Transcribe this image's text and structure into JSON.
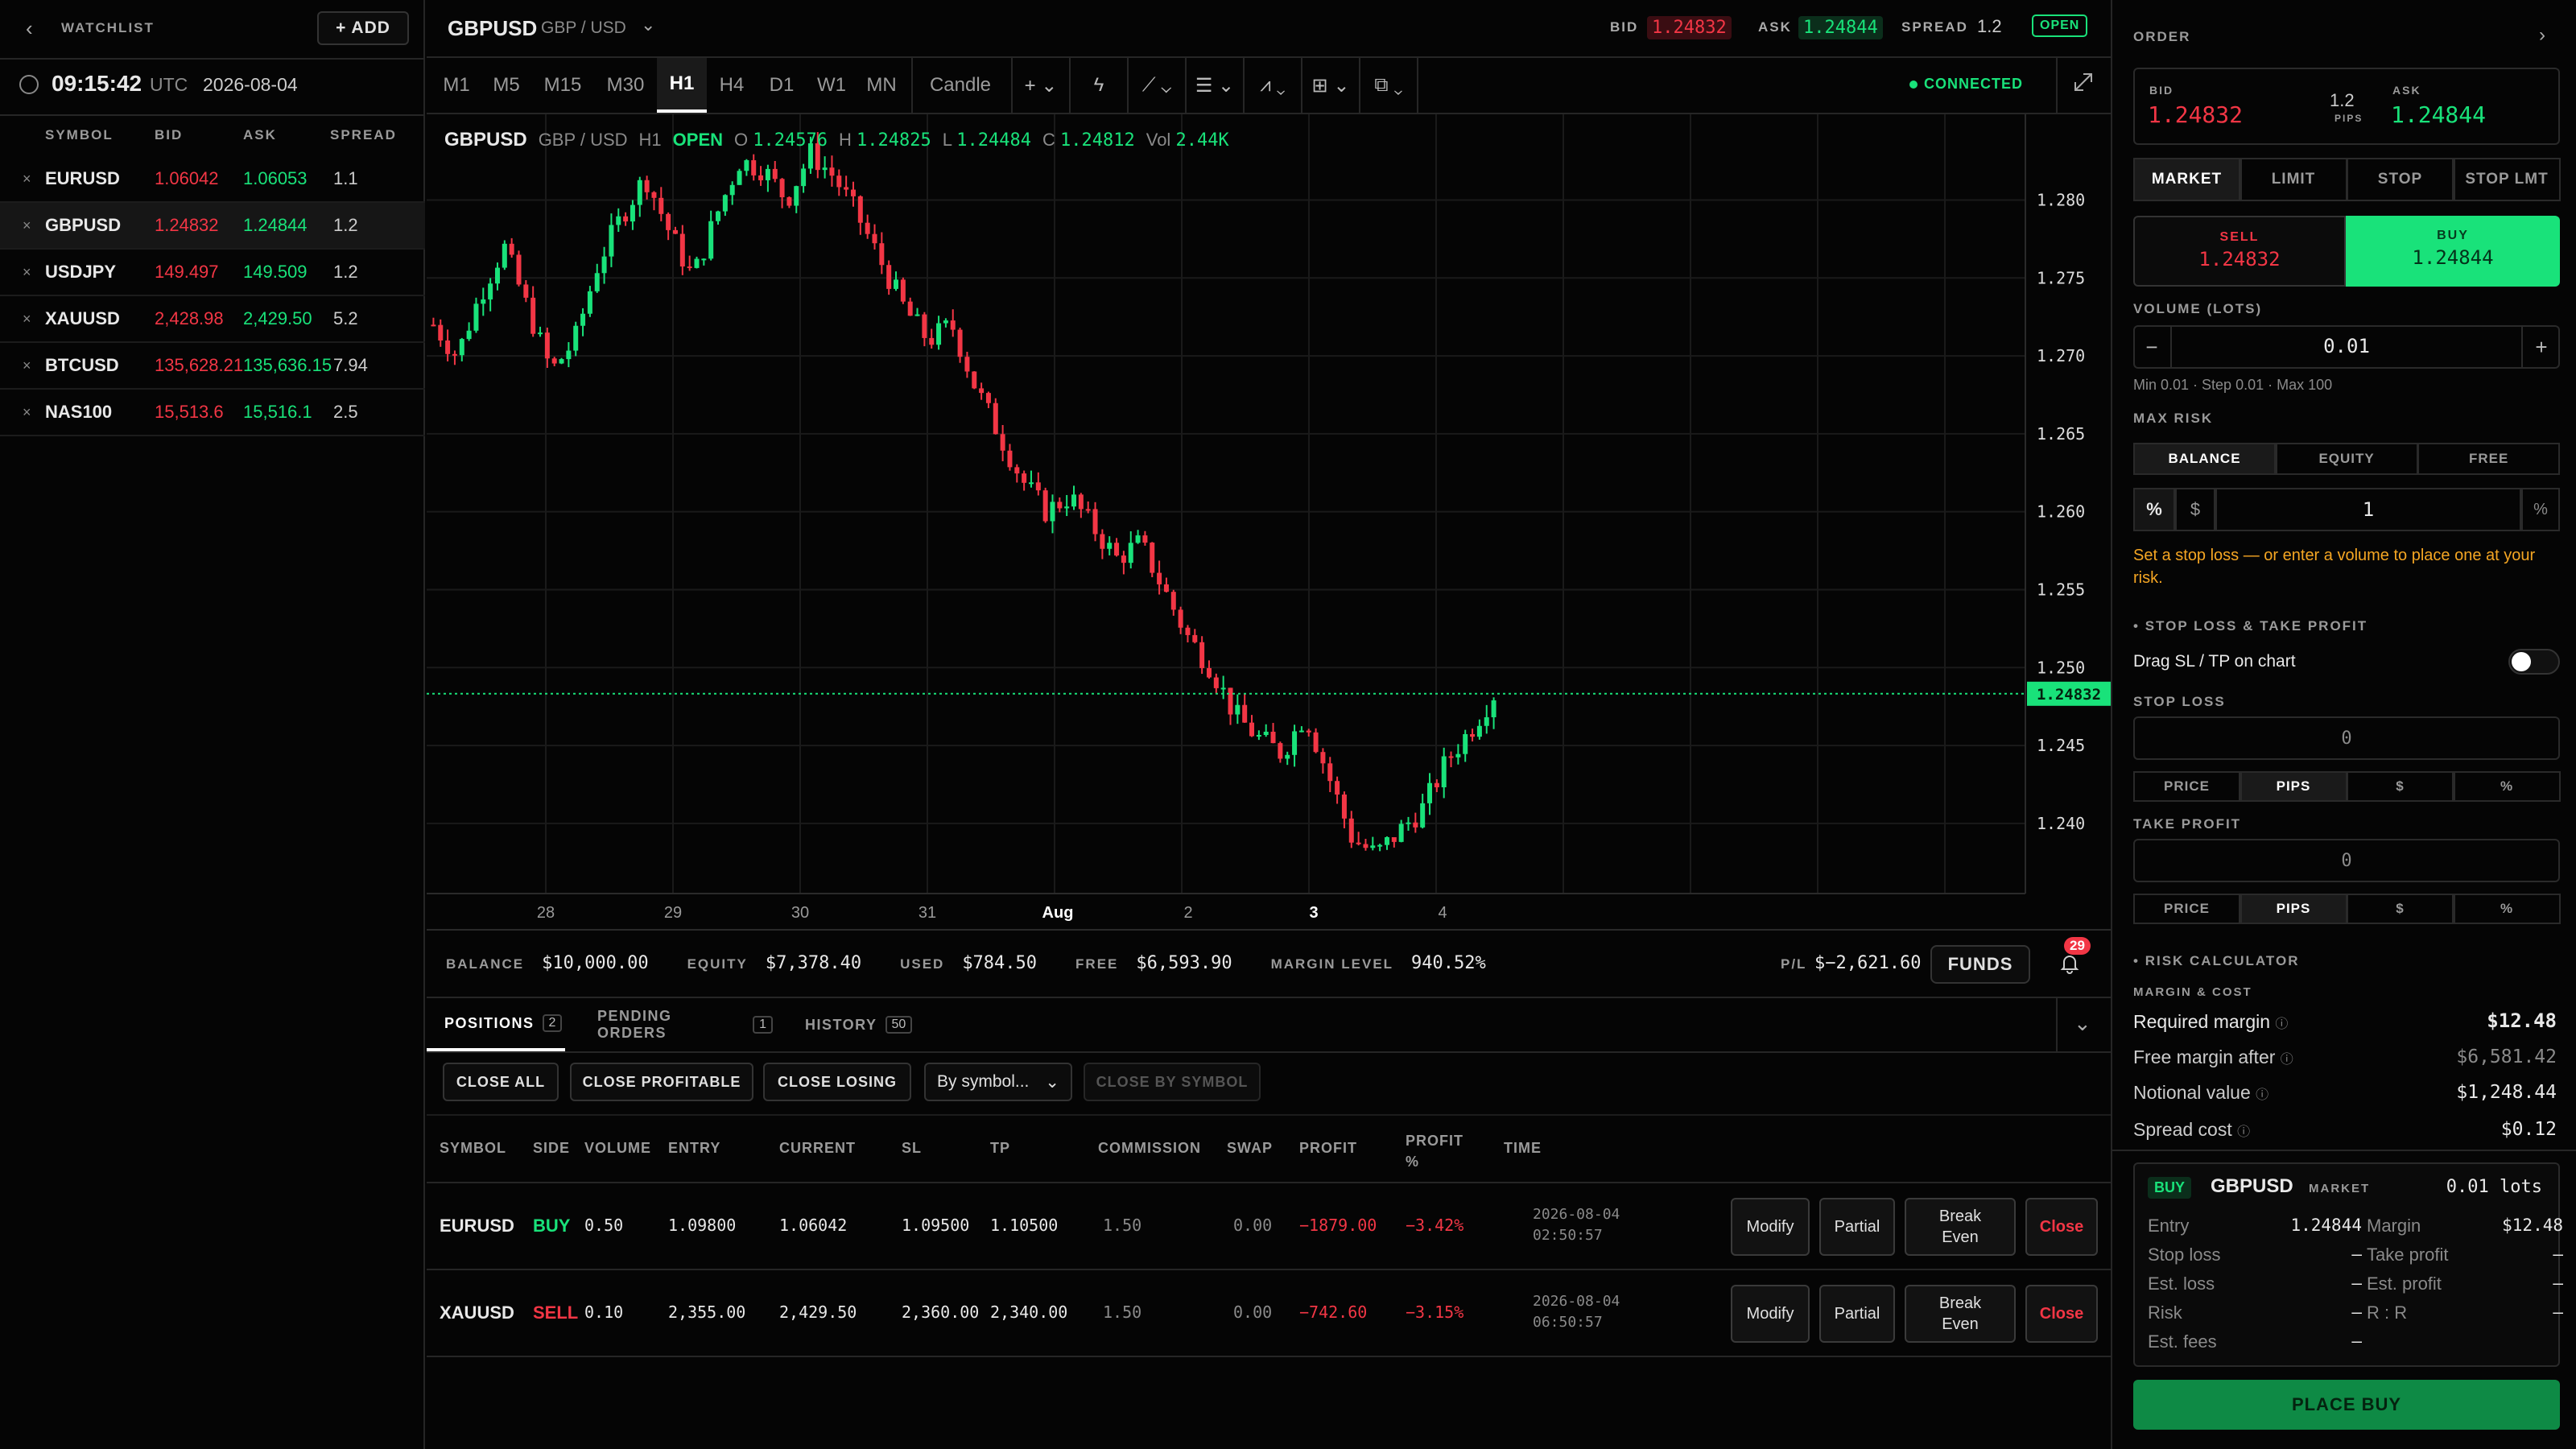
{
  "watchlist": {
    "back_icon": "chevron-left-icon",
    "title": "WATCHLIST",
    "add_label": "+ ADD",
    "clock_icon": "clock-icon",
    "time": "09:15:42",
    "tz": "UTC",
    "date": "2026-08-04",
    "headers": [
      "SYMBOL",
      "BID",
      "ASK",
      "SPREAD"
    ],
    "rows": [
      {
        "remove": "×",
        "symbol": "EURUSD",
        "bid": "1.06042",
        "ask": "1.06053",
        "spread": "1.1"
      },
      {
        "remove": "×",
        "symbol": "GBPUSD",
        "bid": "1.24832",
        "ask": "1.24844",
        "spread": "1.2"
      },
      {
        "remove": "×",
        "symbol": "USDJPY",
        "bid": "149.497",
        "ask": "149.509",
        "spread": "1.2"
      },
      {
        "remove": "×",
        "symbol": "XAUUSD",
        "bid": "2,428.98",
        "ask": "2,429.50",
        "spread": "5.2"
      },
      {
        "remove": "×",
        "symbol": "BTCUSD",
        "bid": "135,628.21",
        "ask": "135,636.15",
        "spread": "7.94"
      },
      {
        "remove": "×",
        "symbol": "NAS100",
        "bid": "15,513.6",
        "ask": "15,516.1",
        "spread": "2.5"
      }
    ]
  },
  "header": {
    "symbol": "GBPUSD",
    "pair": "GBP / USD",
    "chevron": "chevron-down-icon",
    "bid_label": "BID",
    "bid": "1.24832",
    "ask_label": "ASK",
    "ask": "1.24844",
    "spread_label": "SPREAD",
    "spread": "1.2",
    "status": "OPEN"
  },
  "toolbar": {
    "timeframes": [
      "M1",
      "M5",
      "M15",
      "M30",
      "H1",
      "H4",
      "D1",
      "W1",
      "MN"
    ],
    "active": "H1",
    "chart_type": "Candle",
    "tools": [
      "crosshair-icon",
      "lightning-icon",
      "line-tool-icon",
      "indicators-icon",
      "drawing-icon",
      "strategy-icon",
      "compare-icon"
    ],
    "connection": "CONNECTED",
    "expand": "expand-icon"
  },
  "legend": {
    "symbol": "GBPUSD",
    "pair": "GBP / USD",
    "tf": "H1",
    "status": "OPEN",
    "o_label": "O",
    "o": "1.24576",
    "h_label": "H",
    "h": "1.24825",
    "l_label": "L",
    "l": "1.24484",
    "c_label": "C",
    "c": "1.24812",
    "vol_label": "Vol",
    "vol": "2.44K"
  },
  "chart_data": {
    "type": "candlestick",
    "x_labels": [
      "28",
      "29",
      "30",
      "31",
      "Aug",
      "2",
      "3",
      "4"
    ],
    "y_ticks": [
      "1.280",
      "1.275",
      "1.270",
      "1.265",
      "1.260",
      "1.255",
      "1.250",
      "1.245",
      "1.240"
    ],
    "ylim": [
      1.2355,
      1.2855
    ],
    "current_price": "1.24832",
    "current_value": 1.24832,
    "close_path": [
      1.272,
      1.27,
      1.274,
      1.277,
      1.273,
      1.269,
      1.271,
      1.276,
      1.279,
      1.2815,
      1.278,
      1.275,
      1.279,
      1.2825,
      1.282,
      1.28,
      1.283,
      1.2815,
      1.279,
      1.276,
      1.273,
      1.271,
      1.272,
      1.268,
      1.265,
      1.262,
      1.26,
      1.261,
      1.259,
      1.257,
      1.258,
      1.255,
      1.252,
      1.25,
      1.247,
      1.2455,
      1.2445,
      1.247,
      1.243,
      1.239,
      1.238,
      1.2395,
      1.241,
      1.244,
      1.246,
      1.2483
    ]
  },
  "account": {
    "balance_label": "BALANCE",
    "balance": "$10,000.00",
    "equity_label": "EQUITY",
    "equity": "$7,378.40",
    "used_label": "USED",
    "used": "$784.50",
    "free_label": "FREE",
    "free": "$6,593.90",
    "margin_label": "MARGIN LEVEL",
    "margin": "940.52%",
    "pl_label": "P/L",
    "pl": "$−2,621.60",
    "funds": "FUNDS",
    "bell": "bell-icon",
    "notif": "29"
  },
  "tabs": [
    {
      "label": "POSITIONS",
      "count": "2"
    },
    {
      "label": "PENDING ORDERS",
      "count": "1"
    },
    {
      "label": "HISTORY",
      "count": "50"
    }
  ],
  "actions": {
    "close_all": "CLOSE ALL",
    "close_profitable": "CLOSE PROFITABLE",
    "close_losing": "CLOSE LOSING",
    "by_symbol": "By symbol...",
    "close_by_symbol": "CLOSE BY SYMBOL"
  },
  "positions": {
    "headers": [
      "SYMBOL",
      "SIDE",
      "VOLUME",
      "ENTRY",
      "CURRENT",
      "SL",
      "TP",
      "COMMISSION",
      "SWAP",
      "PROFIT",
      "PROFIT %",
      "TIME"
    ],
    "rows": [
      {
        "symbol": "EURUSD",
        "side": "BUY",
        "volume": "0.50",
        "entry": "1.09800",
        "current": "1.06042",
        "sl": "1.09500",
        "tp": "1.10500",
        "commission": "1.50",
        "swap": "0.00",
        "profit": "−1879.00",
        "profit_pct": "−3.42%",
        "date": "2026-08-04",
        "time": "02:50:57"
      },
      {
        "symbol": "XAUUSD",
        "side": "SELL",
        "volume": "0.10",
        "entry": "2,355.00",
        "current": "2,429.50",
        "sl": "2,360.00",
        "tp": "2,340.00",
        "commission": "1.50",
        "swap": "0.00",
        "profit": "−742.60",
        "profit_pct": "−3.15%",
        "date": "2026-08-04",
        "time": "06:50:57"
      }
    ],
    "row_buttons": {
      "modify": "Modify",
      "partial": "Partial",
      "break": "Break",
      "even": "Even",
      "close": "Close"
    }
  },
  "order": {
    "title": "ORDER",
    "bid_label": "BID",
    "bid": "1.24832",
    "spread": "1.2",
    "pips": "PIPS",
    "ask_label": "ASK",
    "ask": "1.24844",
    "types": [
      "MARKET",
      "LIMIT",
      "STOP",
      "STOP LMT"
    ],
    "sell_label": "SELL",
    "sell": "1.24832",
    "buy_label": "BUY",
    "buy": "1.24844",
    "volume_label": "VOLUME (LOTS)",
    "volume": "0.01",
    "volume_hint": "Min 0.01 · Step 0.01 · Max 100",
    "maxrisk_label": "MAX RISK",
    "risk_modes": [
      "BALANCE",
      "EQUITY",
      "FREE"
    ],
    "risk_unit_pct": "%",
    "risk_unit_usd": "$",
    "risk_value": "1",
    "risk_suffix": "%",
    "warning": "Set a stop loss — or enter a volume to place one at your risk.",
    "sltp_title": "STOP LOSS & TAKE PROFIT",
    "drag_label": "Drag SL / TP on chart",
    "sl_label": "STOP LOSS",
    "sl_value": "0",
    "tp_label": "TAKE PROFIT",
    "tp_value": "0",
    "units": [
      "PRICE",
      "PIPS",
      "$",
      "%"
    ],
    "risk_title": "RISK CALCULATOR",
    "margin_cost": "MARGIN & COST",
    "req_margin_label": "Required margin",
    "req_margin": "$12.48",
    "free_after_label": "Free margin after",
    "free_after": "$6,581.42",
    "notional_label": "Notional value",
    "notional": "$1,248.44",
    "spread_cost_label": "Spread cost",
    "spread_cost": "$0.12",
    "summary": {
      "side": "BUY",
      "symbol": "GBPUSD",
      "type": "MARKET",
      "lots": "0.01 lots",
      "entry_label": "Entry",
      "entry": "1.24844",
      "margin_label": "Margin",
      "margin": "$12.48",
      "sl_label": "Stop loss",
      "sl": "–",
      "tp_label": "Take profit",
      "tp": "–",
      "el_label": "Est. loss",
      "el": "–",
      "ep_label": "Est. profit",
      "ep": "–",
      "risk_label": "Risk",
      "risk": "–",
      "rr_label": "R : R",
      "rr": "–",
      "fees_label": "Est. fees",
      "fees": "–"
    },
    "place": "PLACE BUY"
  },
  "colors": {
    "up": "#19e27a",
    "down": "#f23645",
    "accent": "#19e27a",
    "warning": "#f5a623"
  }
}
